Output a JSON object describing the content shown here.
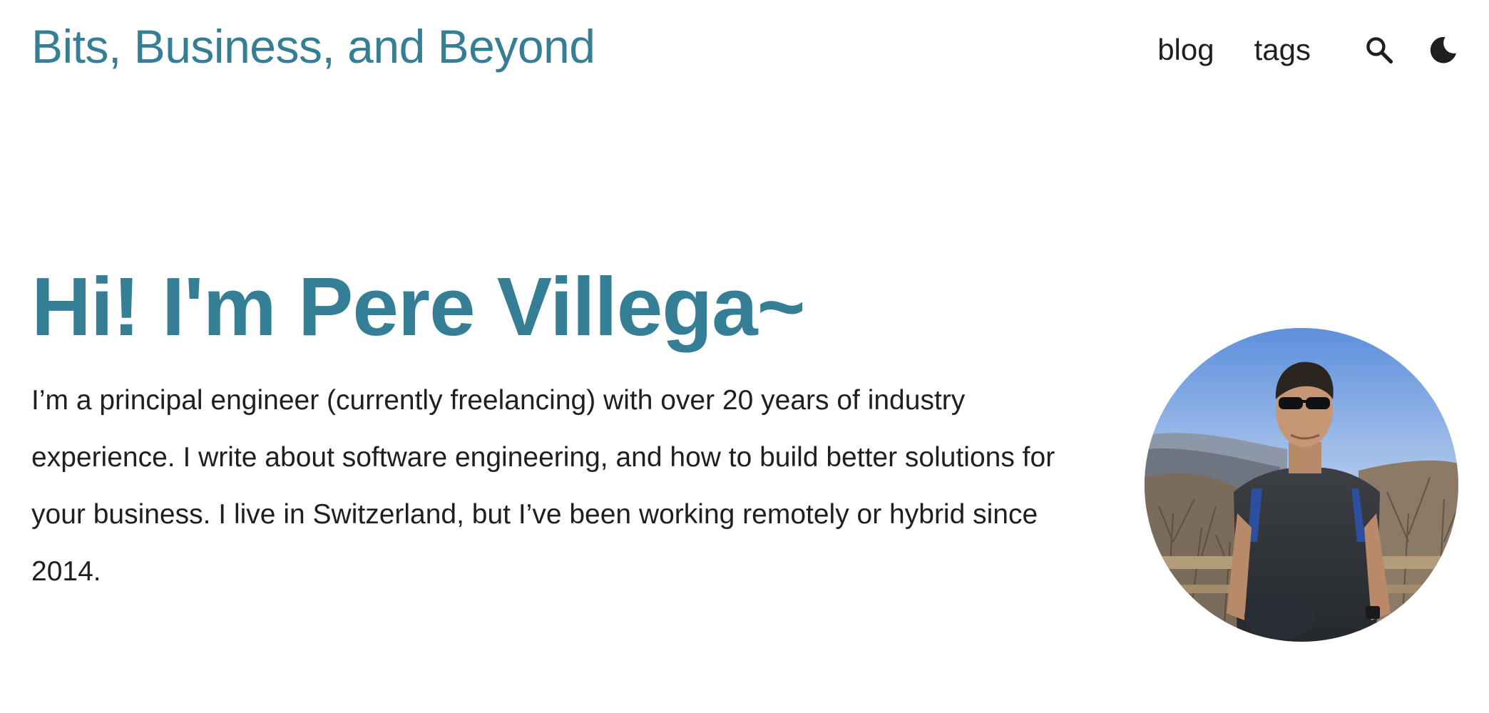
{
  "header": {
    "site_title": "Bits, Business, and Beyond",
    "nav": {
      "blog_label": "blog",
      "tags_label": "tags"
    },
    "icons": {
      "search": "search-icon",
      "theme_toggle": "moon-icon"
    }
  },
  "hero": {
    "title": "Hi! I'm Pere Villega~",
    "intro": "I’m a principal engineer (currently freelancing) with over 20 years of industry experience. I write about software engineering, and how to build better solutions for your business. I live in Switzerland, but I’ve been working remotely or hybrid since 2014."
  },
  "colors": {
    "accent": "#357f96",
    "text": "#1f1f1f",
    "background": "#ffffff"
  }
}
